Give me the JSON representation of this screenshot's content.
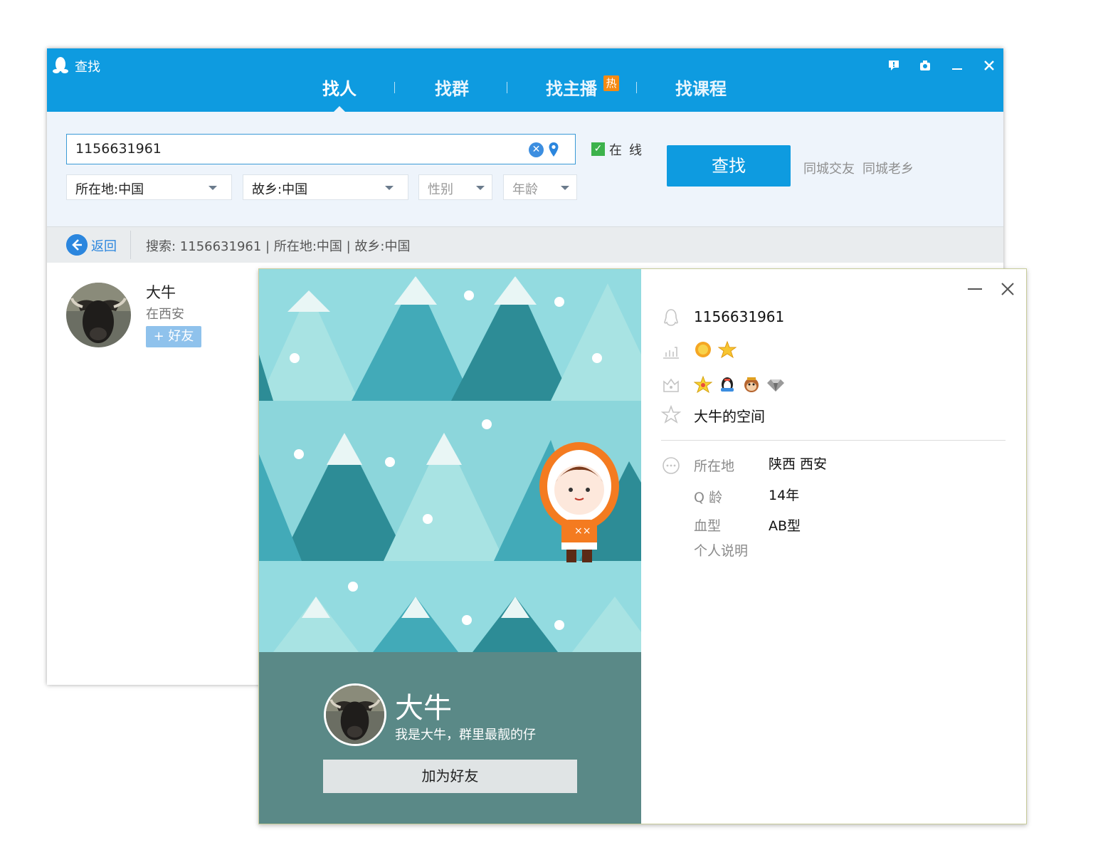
{
  "window": {
    "title": "查找",
    "tabs": [
      "找人",
      "找群",
      "找主播",
      "找课程"
    ],
    "hot_badge": "热"
  },
  "search": {
    "query": "1156631961",
    "location": "所在地:中国",
    "hometown": "故乡:中国",
    "gender_placeholder": "性别",
    "age_placeholder": "年龄",
    "online_label": "在线",
    "online_checked": true,
    "button": "查找",
    "links": [
      "同城交友",
      "同城老乡"
    ]
  },
  "breadcrumb": {
    "back": "返回",
    "text": "搜索:  1156631961  |  所在地:中国  |  故乡:中国"
  },
  "result": {
    "name": "大牛",
    "location": "在西安",
    "add_label": "+ 好友"
  },
  "profile": {
    "name": "大牛",
    "signature": "我是大牛，群里最靓的仔",
    "add_button": "加为好友",
    "qq_number": "1156631961",
    "space": "大牛的空间",
    "fields": [
      {
        "label": "所在地",
        "value": "陕西 西安"
      },
      {
        "label": "Q 龄",
        "value": "14年"
      },
      {
        "label": "血型",
        "value": "AB型"
      },
      {
        "label": "个人说明",
        "value": ""
      }
    ]
  },
  "colors": {
    "title_bar": "#0e9be0",
    "search_panel": "#eef4fb",
    "card_footer": "#5a8987"
  }
}
